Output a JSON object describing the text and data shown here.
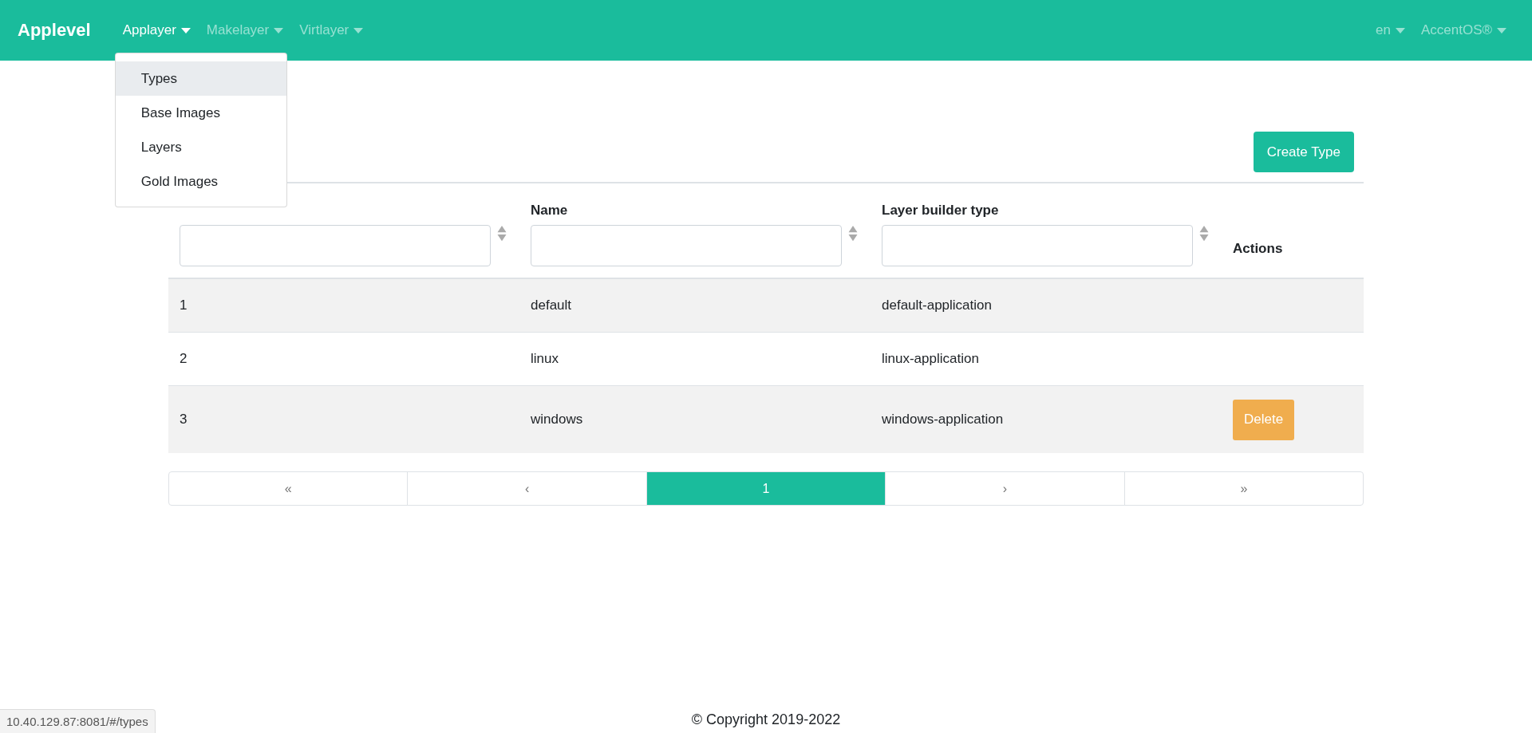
{
  "navbar": {
    "brand": "Applevel",
    "menus": [
      {
        "label": "Applayer",
        "selected": true
      },
      {
        "label": "Makelayer",
        "selected": false
      },
      {
        "label": "Virtlayer",
        "selected": false
      }
    ],
    "right_menus": [
      {
        "label": "en"
      },
      {
        "label": "AccentOS®"
      }
    ]
  },
  "dropdown": {
    "items": [
      {
        "label": "Types",
        "selected": true
      },
      {
        "label": "Base Images",
        "selected": false
      },
      {
        "label": "Layers",
        "selected": false
      },
      {
        "label": "Gold Images",
        "selected": false
      }
    ]
  },
  "create_button": "Create Type",
  "table": {
    "columns": [
      {
        "filter": true
      },
      {
        "label": "Name",
        "filter": true
      },
      {
        "label": "Layer builder type",
        "filter": true
      },
      {
        "label": "Actions",
        "filter": false
      }
    ],
    "rows": [
      {
        "cells": [
          "1",
          "default",
          "default-application"
        ]
      },
      {
        "cells": [
          "2",
          "linux",
          "linux-application"
        ]
      },
      {
        "cells": [
          "3",
          "windows",
          "windows-application"
        ],
        "action": "Delete"
      }
    ]
  },
  "pagination": [
    {
      "label": "«",
      "selected": false
    },
    {
      "label": "‹",
      "selected": false
    },
    {
      "label": "1",
      "selected": true
    },
    {
      "label": "›",
      "selected": false
    },
    {
      "label": "»",
      "selected": false
    }
  ],
  "footer": "© Copyright 2019-2022",
  "status_url": "10.40.129.87:8081/#/types"
}
